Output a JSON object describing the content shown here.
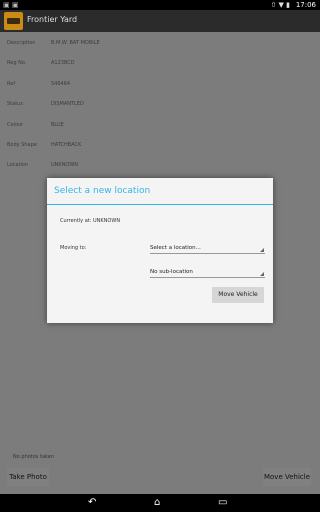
{
  "status_bar": {
    "left_icons": "▣ ▣",
    "icons": "⇧ ▼ ▮",
    "time": "17:06"
  },
  "app": {
    "title": "Frontier Yard"
  },
  "details": [
    {
      "label": "Description",
      "value": "B.M.W. BAT MOBILE"
    },
    {
      "label": "Reg No.",
      "value": "A123BCD"
    },
    {
      "label": "Ref",
      "value": "546464"
    },
    {
      "label": "Status",
      "value": "DISMANTLED"
    },
    {
      "label": "Colour",
      "value": "BLUE"
    },
    {
      "label": "Body Shape",
      "value": "HATCHBACK"
    },
    {
      "label": "Location",
      "value": "UNKNOWN"
    }
  ],
  "photos_note": "No photos taken",
  "buttons": {
    "take_photo": "Take Photo",
    "move_vehicle": "Move Vehicle"
  },
  "dialog": {
    "title": "Select a new location",
    "current": "Currently at: UNKNOWN",
    "moving_to_label": "Moving to:",
    "location_spinner": "Select a location...",
    "sublocation_spinner": "No sub-location",
    "move_button": "Move Vehicle"
  },
  "nav": {
    "back": "back-icon",
    "home": "home-icon",
    "recents": "recents-icon"
  },
  "colors": {
    "accent": "#33b5e5",
    "icon": "#c98a18"
  }
}
